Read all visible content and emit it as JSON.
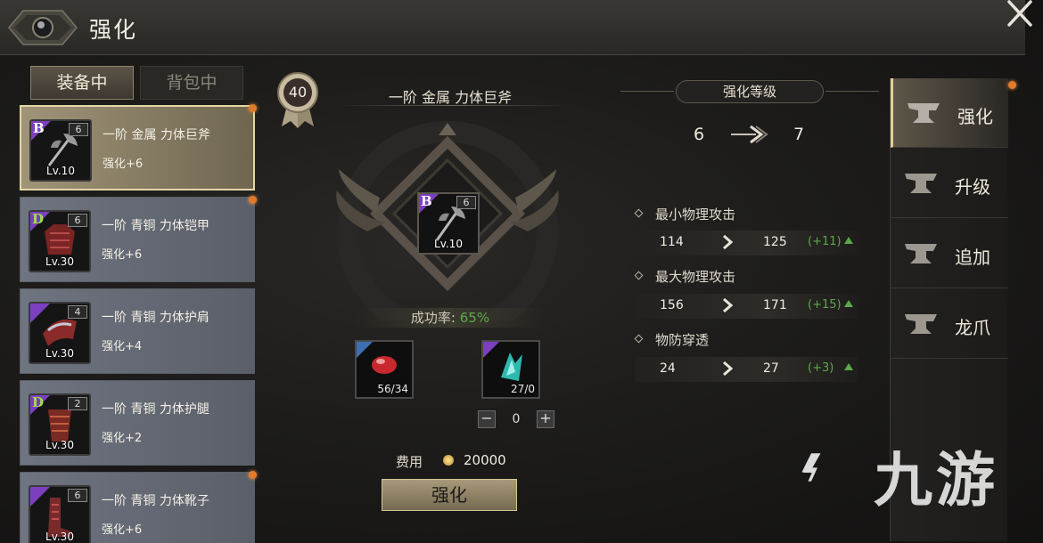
{
  "window": {
    "title": "强化"
  },
  "tabs": {
    "equipped": "装备中",
    "backpack": "背包中"
  },
  "equipment_list": [
    {
      "grade": "B",
      "grade_color": "#7b3fc0",
      "badge": "6",
      "level": "Lv.10",
      "name": "一阶 金属 力体巨斧",
      "enhance": "强化+6",
      "selected": true,
      "alert": true,
      "icon": "axe-icon"
    },
    {
      "grade": "D",
      "grade_color": "#7b3fc0",
      "badge": "6",
      "level": "Lv.30",
      "name": "一阶 青铜 力体铠甲",
      "enhance": "强化+6",
      "selected": false,
      "alert": true,
      "icon": "armor-icon"
    },
    {
      "grade": "",
      "grade_color": "#7b3fc0",
      "badge": "4",
      "level": "Lv.30",
      "name": "一阶 青铜 力体护肩",
      "enhance": "强化+4",
      "selected": false,
      "alert": false,
      "icon": "shoulder-icon"
    },
    {
      "grade": "D",
      "grade_color": "#7b3fc0",
      "badge": "2",
      "level": "Lv.30",
      "name": "一阶 青铜 力体护腿",
      "enhance": "强化+2",
      "selected": false,
      "alert": false,
      "icon": "greaves-icon"
    },
    {
      "grade": "",
      "grade_color": "#7b3fc0",
      "badge": "6",
      "level": "Lv.30",
      "name": "一阶 青铜 力体靴子",
      "enhance": "强化+6",
      "selected": false,
      "alert": true,
      "icon": "boots-icon"
    }
  ],
  "center": {
    "player_level": "40",
    "item_title": "一阶 金属 力体巨斧",
    "item_grade": "B",
    "item_badge": "6",
    "item_level": "Lv.10",
    "success_label": "成功率:",
    "success_value": "65%",
    "materials": [
      {
        "name": "red-stone-icon",
        "count": "56/34"
      },
      {
        "name": "crystal-icon",
        "count": "27/0"
      }
    ],
    "quantity": "0",
    "cost_label": "费用",
    "cost_value": "20000",
    "enhance_button": "强化"
  },
  "stats": {
    "level_title": "强化等级",
    "level_from": "6",
    "level_to": "7",
    "rows": [
      {
        "name": "最小物理攻击",
        "from": "114",
        "to": "125",
        "increase": "(+11)"
      },
      {
        "name": "最大物理攻击",
        "from": "156",
        "to": "171",
        "increase": "(+15)"
      },
      {
        "name": "物防穿透",
        "from": "24",
        "to": "27",
        "increase": "(+3)"
      }
    ]
  },
  "menu": [
    {
      "label": "强化",
      "active": true
    },
    {
      "label": "升级",
      "active": false
    },
    {
      "label": "追加",
      "active": false
    },
    {
      "label": "龙爪",
      "active": false
    }
  ],
  "watermark": {
    "text": "九游"
  },
  "colors": {
    "accent": "#e4cf96",
    "increase": "#5da74b",
    "alert": "#e07b2c",
    "grade_purple": "#7b3fc0"
  }
}
